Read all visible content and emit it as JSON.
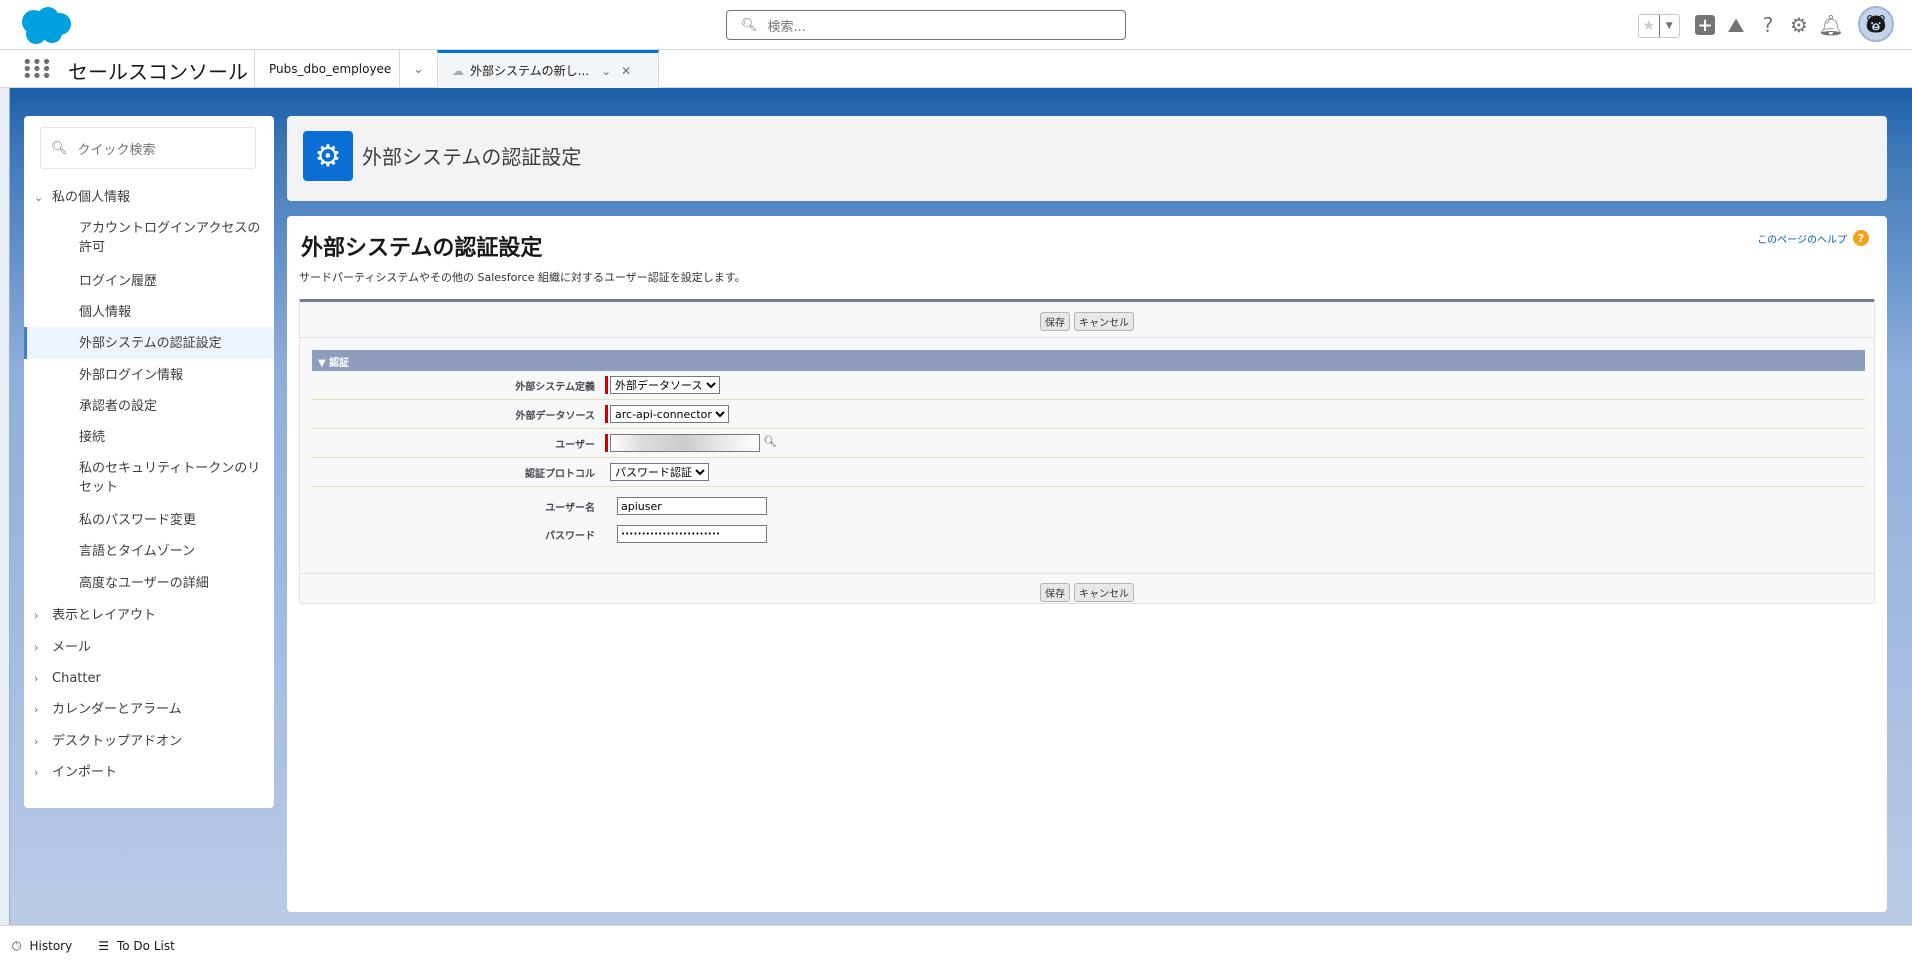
{
  "header": {
    "search_placeholder": "検索...",
    "app_name": "セールスコンソール"
  },
  "tabs": [
    {
      "label": "Pubs_dbo_employee"
    },
    {
      "label": "外部システムの新し..."
    }
  ],
  "sidebar": {
    "search_placeholder": "クイック検索",
    "group_open": "私の個人情報",
    "items": [
      "アカウントログインアクセスの許可",
      "ログイン履歴",
      "個人情報",
      "外部システムの認証設定",
      "外部ログイン情報",
      "承認者の設定",
      "接続",
      "私のセキュリティトークンのリセット",
      "私のパスワード変更",
      "言語とタイムゾーン",
      "高度なユーザーの詳細"
    ],
    "groups": [
      "表示とレイアウト",
      "メール",
      "Chatter",
      "カレンダーとアラーム",
      "デスクトップアドオン",
      "インポート"
    ]
  },
  "page": {
    "header_title": "外部システムの認証設定",
    "title": "外部システムの認証設定",
    "description": "サードパーティシステムやその他の Salesforce 組織に対するユーザー認証を設定します。",
    "help": "このページのヘルプ"
  },
  "form": {
    "save": "保存",
    "cancel": "キャンセル",
    "section": "▼ 認証",
    "fields": {
      "ext_def_label": "外部システム定義",
      "ext_def_value": "外部データソース",
      "ext_src_label": "外部データソース",
      "ext_src_value": "arc-api-connector",
      "user_label": "ユーザー",
      "protocol_label": "認証プロトコル",
      "protocol_value": "パスワード認証",
      "username_label": "ユーザー名",
      "username_value": "apiuser",
      "password_label": "パスワード",
      "password_value": "••••••••••••••••••••••••"
    }
  },
  "footer": {
    "history": "History",
    "todo": "To Do List"
  }
}
